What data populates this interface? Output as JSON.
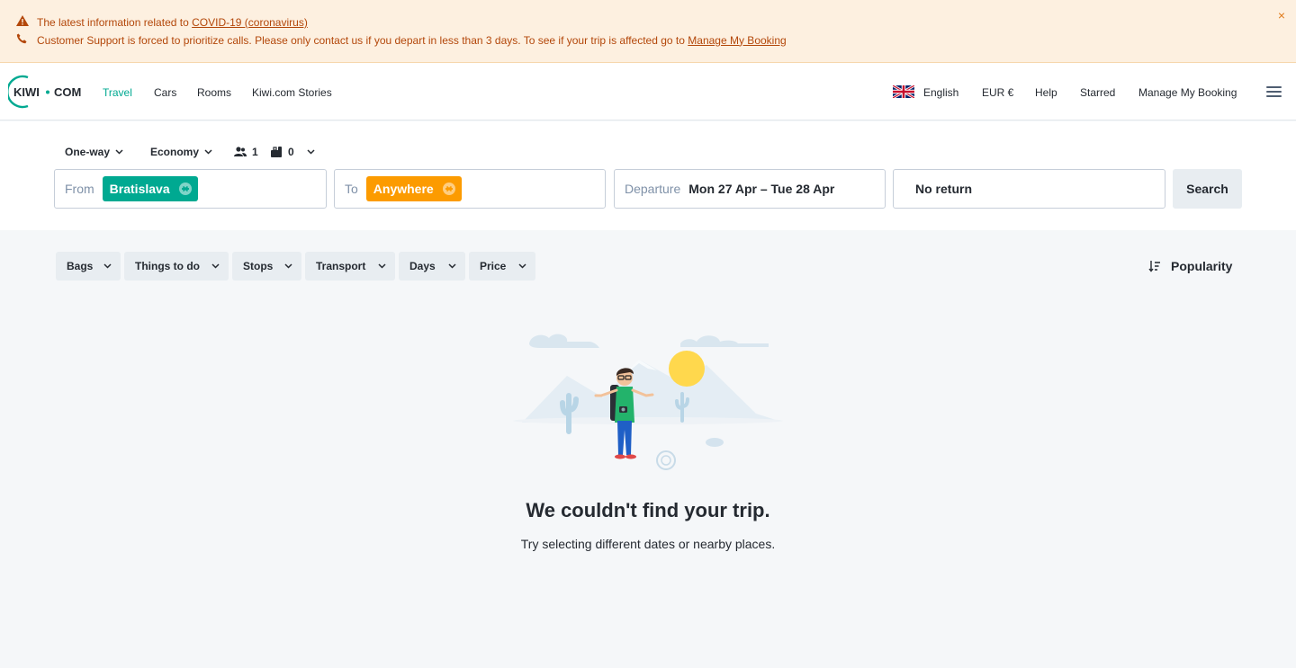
{
  "alert": {
    "line1_prefix": "The latest information related to ",
    "line1_link": "COVID-19 (coronavirus)",
    "line2_text": "Customer Support is forced to prioritize calls. Please only contact us if you depart in less than 3 days. To see if your trip is affected go to ",
    "line2_link": "Manage My Booking",
    "close": "×"
  },
  "header": {
    "logo_text": {
      "left": "KIWI",
      "right": "COM"
    },
    "nav": [
      "Travel",
      "Cars",
      "Rooms",
      "Kiwi.com Stories"
    ],
    "language": "English",
    "currency": "EUR €",
    "help": "Help",
    "starred": "Starred",
    "manage": "Manage My Booking"
  },
  "search": {
    "trip_type": "One-way",
    "cabin": "Economy",
    "passengers": "1",
    "bags": "0",
    "from_label": "From",
    "from_value": "Bratislava",
    "to_label": "To",
    "to_value": "Anywhere",
    "departure_label": "Departure",
    "departure_value": "Mon 27 Apr – Tue 28 Apr",
    "return_value": "No return",
    "search_button": "Search"
  },
  "filters": [
    "Bags",
    "Things to do",
    "Stops",
    "Transport",
    "Days",
    "Price"
  ],
  "sort": {
    "label": "Popularity"
  },
  "empty": {
    "title": "We couldn't find your trip.",
    "subtitle": "Try selecting different dates or nearby places."
  },
  "colors": {
    "accent": "#00a991",
    "orange": "#fc9b00",
    "alert_text": "#b3470a",
    "alert_bg": "#fdf0e0"
  }
}
